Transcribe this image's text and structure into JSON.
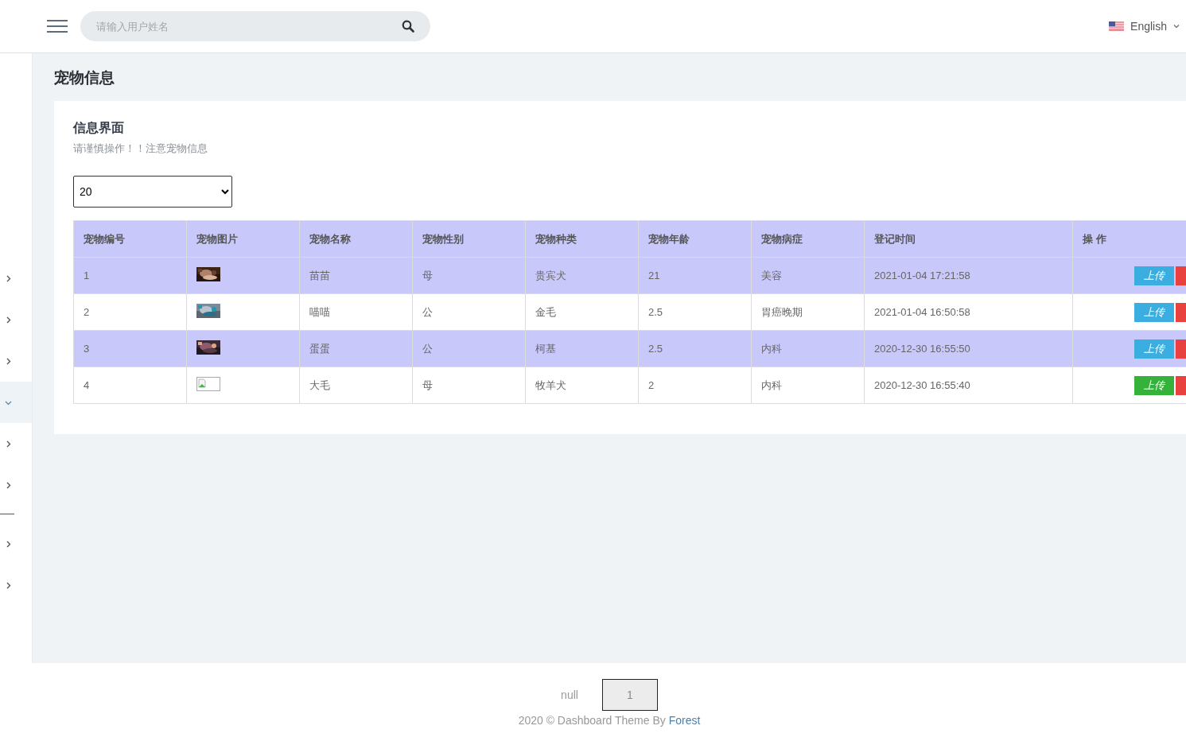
{
  "header": {
    "search": {
      "placeholder": "请输入用户姓名"
    },
    "language": "English"
  },
  "sidebar": {
    "items": [
      {
        "kind": "chevron",
        "expanded": false
      },
      {
        "kind": "chevron",
        "expanded": false
      },
      {
        "kind": "chevron",
        "expanded": false
      },
      {
        "kind": "chevron",
        "expanded": true
      },
      {
        "kind": "chevron",
        "expanded": false
      },
      {
        "kind": "chevron",
        "expanded": false
      },
      {
        "kind": "divider"
      },
      {
        "kind": "chevron",
        "expanded": false
      },
      {
        "kind": "chevron",
        "expanded": false
      }
    ]
  },
  "page_title": "宠物信息",
  "card": {
    "title": "信息界面",
    "subtitle": "请谨慎操作！！注意宠物信息",
    "page_size": "20",
    "table": {
      "columns": [
        "宠物编号",
        "宠物图片",
        "宠物名称",
        "宠物性别",
        "宠物种类",
        "宠物年龄",
        "宠物病症",
        "登记时间",
        "操 作"
      ],
      "rows": [
        {
          "highlighted": true,
          "id": "1",
          "name": "苗苗",
          "sex": "母",
          "breed": "贵宾犬",
          "age": "21",
          "illness": "美容",
          "time": "2021-01-04 17:21:58",
          "action": "上传",
          "hover": false
        },
        {
          "highlighted": false,
          "id": "2",
          "name": "喵喵",
          "sex": "公",
          "breed": "金毛",
          "age": "2.5",
          "illness": "胃癌晚期",
          "time": "2021-01-04 16:50:58",
          "action": "上传",
          "hover": false
        },
        {
          "highlighted": true,
          "id": "3",
          "name": "蛋蛋",
          "sex": "公",
          "breed": "柯基",
          "age": "2.5",
          "illness": "内科",
          "time": "2020-12-30 16:55:50",
          "action": "上传",
          "hover": false
        },
        {
          "highlighted": false,
          "id": "4",
          "photo": {
            "kind": "broken"
          },
          "name": "大毛",
          "sex": "母",
          "breed": "牧羊犬",
          "age": "2",
          "illness": "内科",
          "time": "2020-12-30 16:55:40",
          "action": "上传",
          "hover": true
        }
      ]
    }
  },
  "pagination": {
    "label": "null",
    "pages": [
      {
        "label": "1",
        "selected": true
      }
    ]
  },
  "footer": {
    "text": "2020 © Dashboard Theme By ",
    "link": "Forest"
  }
}
